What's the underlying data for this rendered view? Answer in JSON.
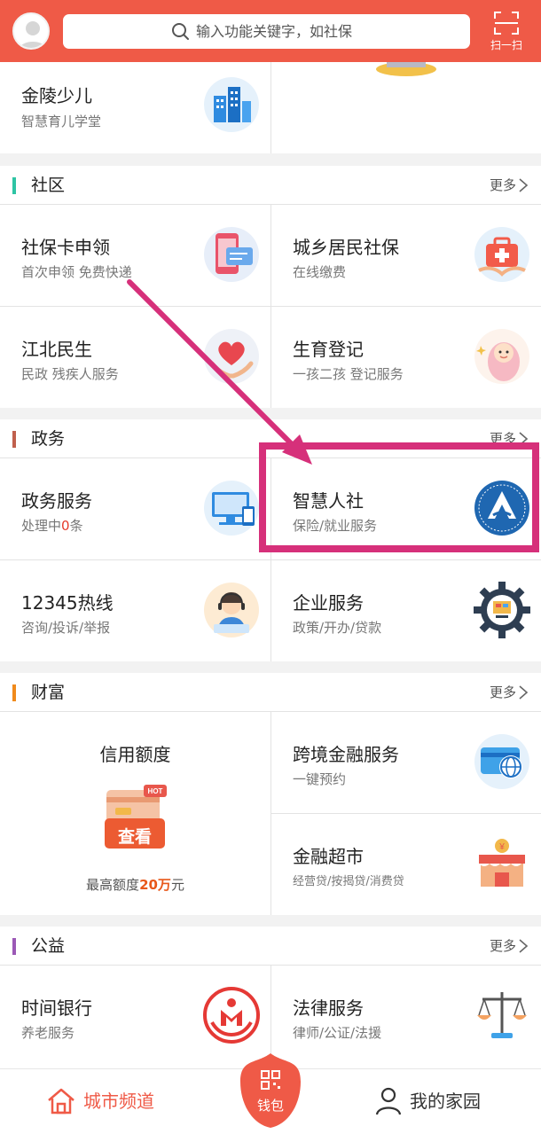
{
  "header": {
    "search_placeholder": "输入功能关键字，如社保",
    "scan_label": "扫一扫"
  },
  "top_tiles": [
    {
      "title": "金陵少儿",
      "subtitle": "智慧育儿学堂"
    }
  ],
  "sections": {
    "community": {
      "title": "社区",
      "more": "更多",
      "color": "#2ec4a4",
      "tiles": [
        {
          "title": "社保卡申领",
          "subtitle": "首次申领 免费快递"
        },
        {
          "title": "城乡居民社保",
          "subtitle": "在线缴费"
        },
        {
          "title": "江北民生",
          "subtitle": "民政 残疾人服务"
        },
        {
          "title": "生育登记",
          "subtitle": "一孩二孩 登记服务"
        }
      ]
    },
    "government": {
      "title": "政务",
      "more": "更多",
      "color": "#c0604d",
      "tiles": [
        {
          "title": "政务服务",
          "subtitle_prefix": "处理中",
          "subtitle_count": "0",
          "subtitle_suffix": "条"
        },
        {
          "title": "智慧人社",
          "subtitle": "保险/就业服务"
        },
        {
          "title": "12345热线",
          "subtitle": "咨询/投诉/举报"
        },
        {
          "title": "企业服务",
          "subtitle": "政策/开办/贷款"
        }
      ]
    },
    "wealth": {
      "title": "财富",
      "more": "更多",
      "color": "#f08a1c",
      "credit": {
        "title": "信用额度",
        "badge": "HOT",
        "button": "查看",
        "sub_prefix": "最高额度",
        "sub_amount": "20万",
        "sub_suffix": "元"
      },
      "tiles": [
        {
          "title": "跨境金融服务",
          "subtitle": "一键预约"
        },
        {
          "title": "金融超市",
          "subtitle": "经营贷/按揭贷/消费贷"
        }
      ]
    },
    "welfare": {
      "title": "公益",
      "more": "更多",
      "color": "#9b59b6",
      "tiles": [
        {
          "title": "时间银行",
          "subtitle": "养老服务"
        },
        {
          "title": "法律服务",
          "subtitle": "律师/公证/法援"
        }
      ]
    }
  },
  "bottom_nav": {
    "home": "城市频道",
    "wallet": "钱包",
    "my": "我的家园"
  },
  "colors": {
    "brand": "#ef5a47",
    "highlight_annotation": "#d6307a"
  }
}
